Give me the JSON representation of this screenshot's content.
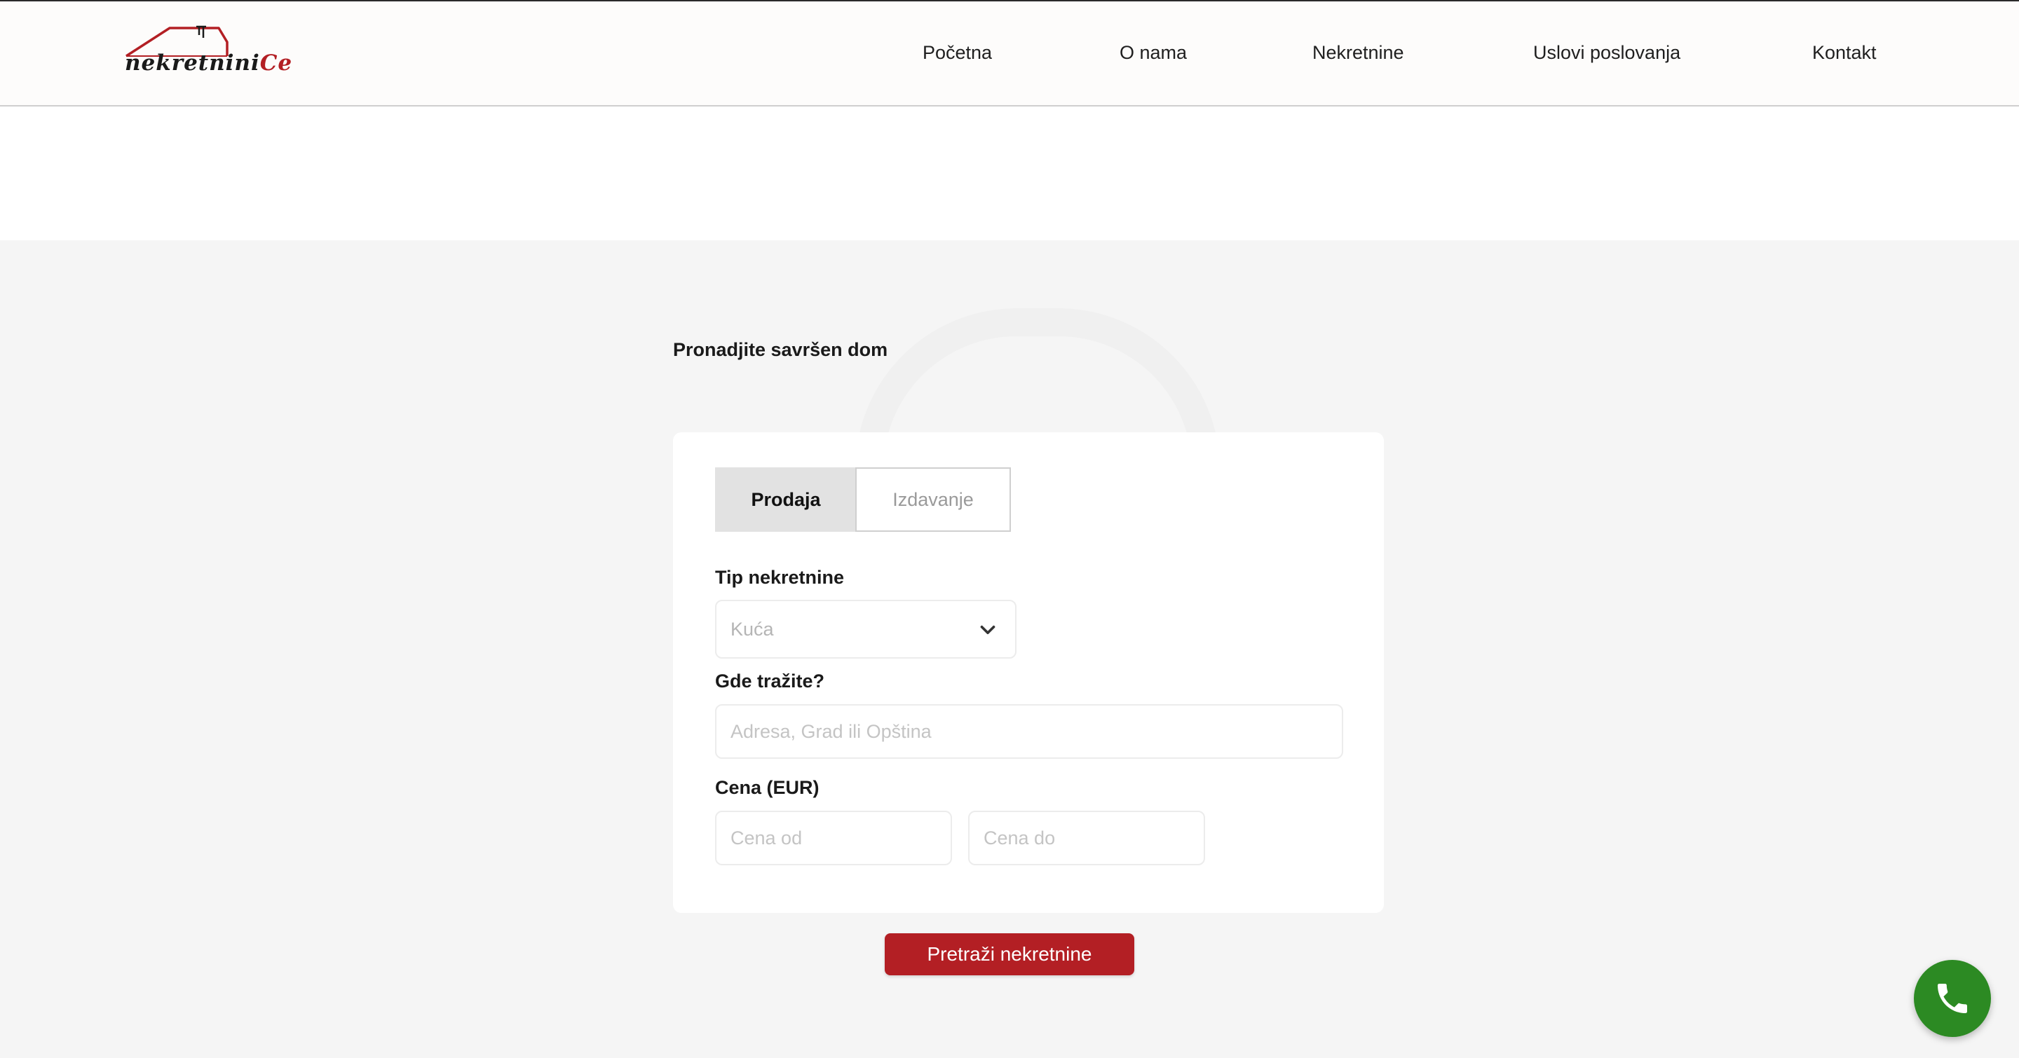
{
  "header": {
    "logo_text": "nekretnini",
    "logo_suffix": "Ce",
    "nav": [
      {
        "label": "Početna"
      },
      {
        "label": "O nama"
      },
      {
        "label": "Nekretnine"
      },
      {
        "label": "Uslovi poslovanja"
      },
      {
        "label": "Kontakt"
      }
    ]
  },
  "search": {
    "title": "Pronadjite savršen dom",
    "tabs": [
      {
        "label": "Prodaja",
        "active": true
      },
      {
        "label": "Izdavanje",
        "active": false
      }
    ],
    "property_type": {
      "label": "Tip nekretnine",
      "value": "Kuća",
      "icon": "chevron-down-icon"
    },
    "location": {
      "label": "Gde tražite?",
      "placeholder": "Adresa, Grad ili Opština",
      "value": ""
    },
    "price": {
      "label": "Cena (EUR)",
      "from_placeholder": "Cena od",
      "to_placeholder": "Cena do"
    },
    "submit_label": "Pretraži nekretnine"
  },
  "floating": {
    "call_icon": "phone-icon",
    "color": "#2c8a23"
  },
  "colors": {
    "brand_red": "#b31f24",
    "call_green": "#2c8a23",
    "page_bg": "#f5f5f5"
  }
}
